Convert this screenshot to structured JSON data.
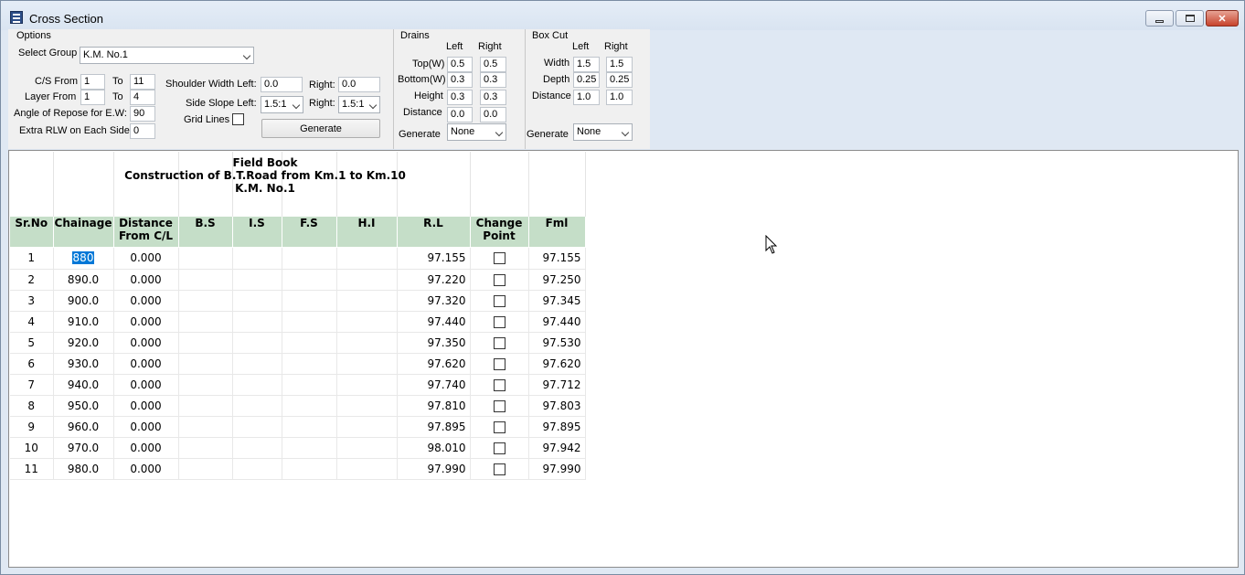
{
  "window": {
    "title": "Cross Section"
  },
  "options": {
    "group_label": "Options",
    "select_group_label": "Select Group",
    "select_group_value": "K.M. No.1",
    "cs_from_label": "C/S From",
    "cs_from": "1",
    "to_label": "To",
    "cs_to": "11",
    "layer_from_label": "Layer From",
    "layer_from": "1",
    "layer_to": "4",
    "angle_label": "Angle of Repose for E.W:",
    "angle_value": "90",
    "extra_rlw_label": "Extra RLW on Each Side:",
    "extra_rlw_value": "0",
    "shoulder_left_label": "Shoulder Width Left:",
    "shoulder_left": "0.0",
    "shoulder_right_label": "Right:",
    "shoulder_right": "0.0",
    "side_slope_left_label": "Side Slope Left:",
    "side_slope_left": "1.5:1",
    "side_slope_right_label": "Right:",
    "side_slope_right": "1.5:1",
    "grid_lines_label": "Grid Lines",
    "generate_label": "Generate"
  },
  "drains": {
    "group_label": "Drains",
    "left_label": "Left",
    "right_label": "Right",
    "top_label": "Top(W)",
    "top_left": "0.5",
    "top_right": "0.5",
    "bottom_label": "Bottom(W)",
    "bottom_left": "0.3",
    "bottom_right": "0.3",
    "height_label": "Height",
    "height_left": "0.3",
    "height_right": "0.3",
    "distance_label": "Distance",
    "distance_left": "0.0",
    "distance_right": "0.0",
    "generate_label": "Generate",
    "generate_value": "None"
  },
  "boxcut": {
    "group_label": "Box Cut",
    "left_label": "Left",
    "right_label": "Right",
    "width_label": "Width",
    "width_left": "1.5",
    "width_right": "1.5",
    "depth_label": "Depth",
    "depth_left": "0.25",
    "depth_right": "0.25",
    "distance_label": "Distance",
    "distance_left": "1.0",
    "distance_right": "1.0",
    "generate_label": "Generate",
    "generate_value": "None"
  },
  "report": {
    "line1": "Field Book",
    "line2": "Construction of B.T.Road from Km.1 to Km.10",
    "line3": "K.M. No.1"
  },
  "table": {
    "headers": [
      "Sr.No",
      "Chainage",
      "Distance From C/L",
      "B.S",
      "I.S",
      "F.S",
      "H.I",
      "R.L",
      "Change Point",
      "Fml"
    ],
    "rows": [
      {
        "sr": "1",
        "chainage": "880",
        "dist": "0.000",
        "rl": "97.155",
        "fml": "97.155"
      },
      {
        "sr": "2",
        "chainage": "890.0",
        "dist": "0.000",
        "rl": "97.220",
        "fml": "97.250"
      },
      {
        "sr": "3",
        "chainage": "900.0",
        "dist": "0.000",
        "rl": "97.320",
        "fml": "97.345"
      },
      {
        "sr": "4",
        "chainage": "910.0",
        "dist": "0.000",
        "rl": "97.440",
        "fml": "97.440"
      },
      {
        "sr": "5",
        "chainage": "920.0",
        "dist": "0.000",
        "rl": "97.350",
        "fml": "97.530"
      },
      {
        "sr": "6",
        "chainage": "930.0",
        "dist": "0.000",
        "rl": "97.620",
        "fml": "97.620"
      },
      {
        "sr": "7",
        "chainage": "940.0",
        "dist": "0.000",
        "rl": "97.740",
        "fml": "97.712"
      },
      {
        "sr": "8",
        "chainage": "950.0",
        "dist": "0.000",
        "rl": "97.810",
        "fml": "97.803"
      },
      {
        "sr": "9",
        "chainage": "960.0",
        "dist": "0.000",
        "rl": "97.895",
        "fml": "97.895"
      },
      {
        "sr": "10",
        "chainage": "970.0",
        "dist": "0.000",
        "rl": "98.010",
        "fml": "97.942"
      },
      {
        "sr": "11",
        "chainage": "980.0",
        "dist": "0.000",
        "rl": "97.990",
        "fml": "97.990"
      }
    ]
  },
  "colors": {
    "header_bg": "#c5dec8",
    "selection": "#0078d7",
    "close_button": "#c7432c"
  }
}
